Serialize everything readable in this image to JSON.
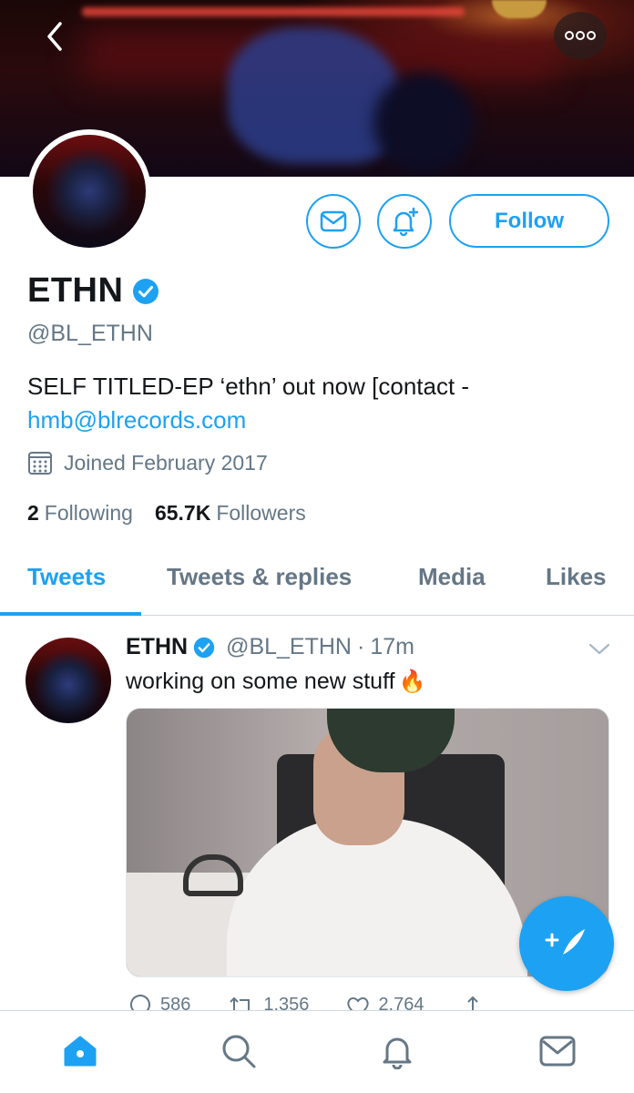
{
  "colors": {
    "accent": "#1da1f2",
    "secondary_text": "#657786",
    "primary_text": "#14171a",
    "verified": "#1da1f2"
  },
  "header": {
    "back_icon": "chevron-left-icon",
    "more_icon": "more-horizontal-icon"
  },
  "profile": {
    "name": "ETHN",
    "handle": "@BL_ETHN",
    "bio_text": "SELF TITLED-EP ‘ethn’ out now [contact -",
    "bio_link": "hmb@blrecords.com",
    "joined": "Joined February 2017",
    "following_count": "2",
    "following_label": "Following",
    "followers_count": "65.7K",
    "followers_label": "Followers"
  },
  "actions": {
    "message_icon": "mail-icon",
    "notify_icon": "bell-plus-icon",
    "follow_label": "Follow"
  },
  "tabs": [
    {
      "label": "Tweets",
      "active": true
    },
    {
      "label": "Tweets & replies",
      "active": false
    },
    {
      "label": "Media",
      "active": false
    },
    {
      "label": "Likes",
      "active": false
    }
  ],
  "tweet": {
    "name": "ETHN",
    "handle": "@BL_ETHN",
    "separator": "·",
    "time": "17m",
    "text": "working on some new stuff",
    "emoji": "🔥",
    "replies": "586",
    "retweets": "1,356",
    "likes": "2,764"
  },
  "fab": {
    "icon": "compose-tweet-icon"
  },
  "bottom_nav": [
    {
      "icon": "home-icon",
      "active": true
    },
    {
      "icon": "search-icon",
      "active": false
    },
    {
      "icon": "bell-icon",
      "active": false
    },
    {
      "icon": "mail-icon",
      "active": false
    }
  ]
}
